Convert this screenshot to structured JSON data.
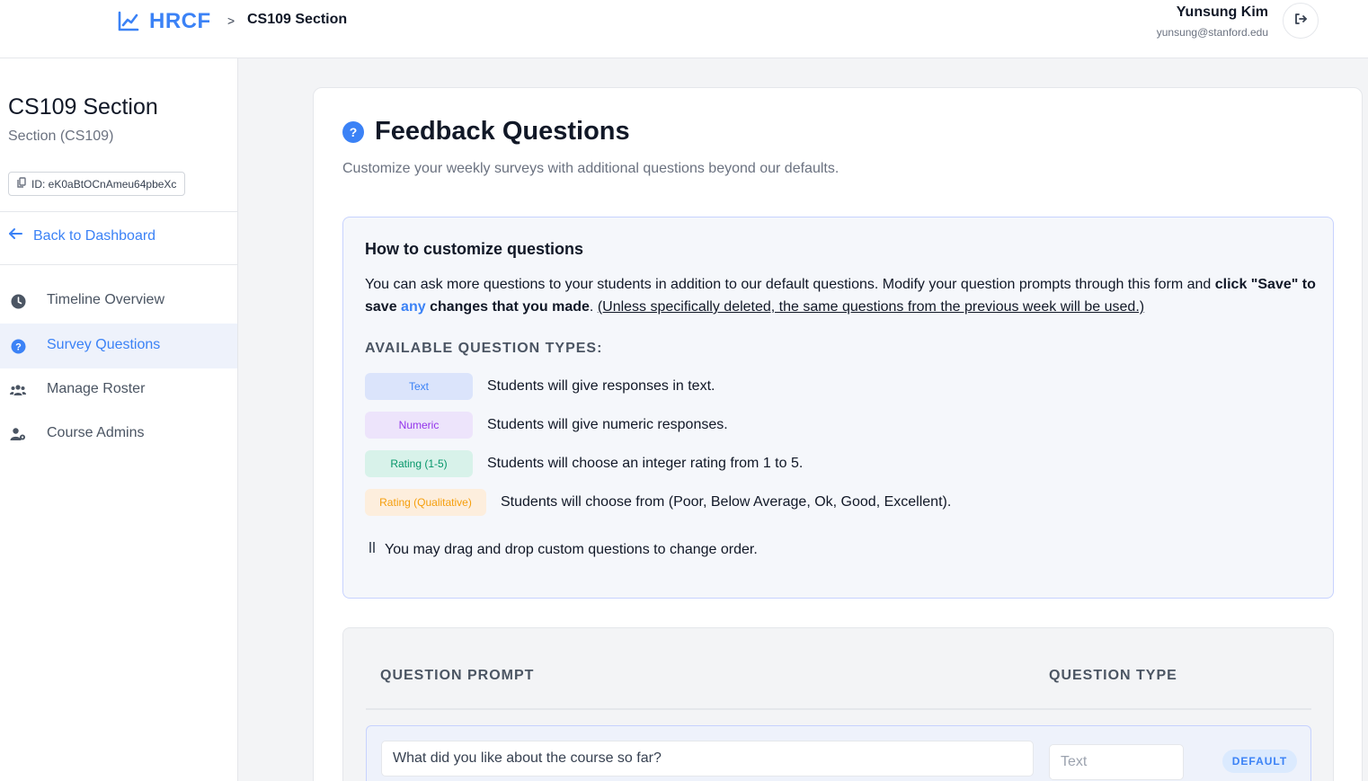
{
  "header": {
    "brand": "HRCF",
    "breadcrumb_sep": ">",
    "breadcrumb_page": "CS109 Section",
    "user_name": "Yunsung Kim",
    "user_email": "yunsung@stanford.edu"
  },
  "sidebar": {
    "course_title": "CS109 Section",
    "course_subtitle": "Section (CS109)",
    "course_id": "ID: eK0aBtOCnAmeu64pbeXc",
    "back_label": "Back to Dashboard",
    "items": [
      {
        "label": "Timeline Overview",
        "icon": "clock-icon"
      },
      {
        "label": "Survey Questions",
        "icon": "question-circle-icon",
        "active": true
      },
      {
        "label": "Manage Roster",
        "icon": "users-icon"
      },
      {
        "label": "Course Admins",
        "icon": "user-cog-icon"
      }
    ]
  },
  "main": {
    "title": "Feedback Questions",
    "description": "Customize your weekly surveys with additional questions beyond our defaults.",
    "howto": {
      "title": "How to customize questions",
      "para_1": "You can ask more questions to your students in addition to our default questions. Modify your question prompts through this form and",
      "para_bold_1": "click \"Save\" to save",
      "para_any": "any",
      "para_bold_2": "changes that you made",
      "para_period": ".",
      "para_note": "(Unless specifically deleted, the same questions from the previous week will be used.)",
      "types_label": "AVAILABLE QUESTION TYPES:",
      "types": [
        {
          "badge": "Text",
          "desc": "Students will give responses in text."
        },
        {
          "badge": "Numeric",
          "desc": "Students will give numeric responses."
        },
        {
          "badge": "Rating (1-5)",
          "desc": "Students will choose an integer rating from 1 to 5."
        },
        {
          "badge": "Rating (Qualitative)",
          "desc": "Students will choose from (Poor, Below Average, Ok, Good, Excellent)."
        }
      ],
      "drag_note": "You may drag and drop custom questions to change order."
    },
    "table": {
      "col_prompt": "QUESTION PROMPT",
      "col_type": "QUESTION TYPE",
      "rows": [
        {
          "prompt": "What did you like about the course so far?",
          "type": "Text",
          "tag": "DEFAULT"
        }
      ]
    }
  },
  "colors": {
    "accent": "#3b82f6",
    "text_badge_bg": "#dbe4fb",
    "numeric_badge_bg": "#ede4fb",
    "rating_badge_bg": "#d8f2ea",
    "qualitative_badge_bg": "#fdeedd"
  }
}
